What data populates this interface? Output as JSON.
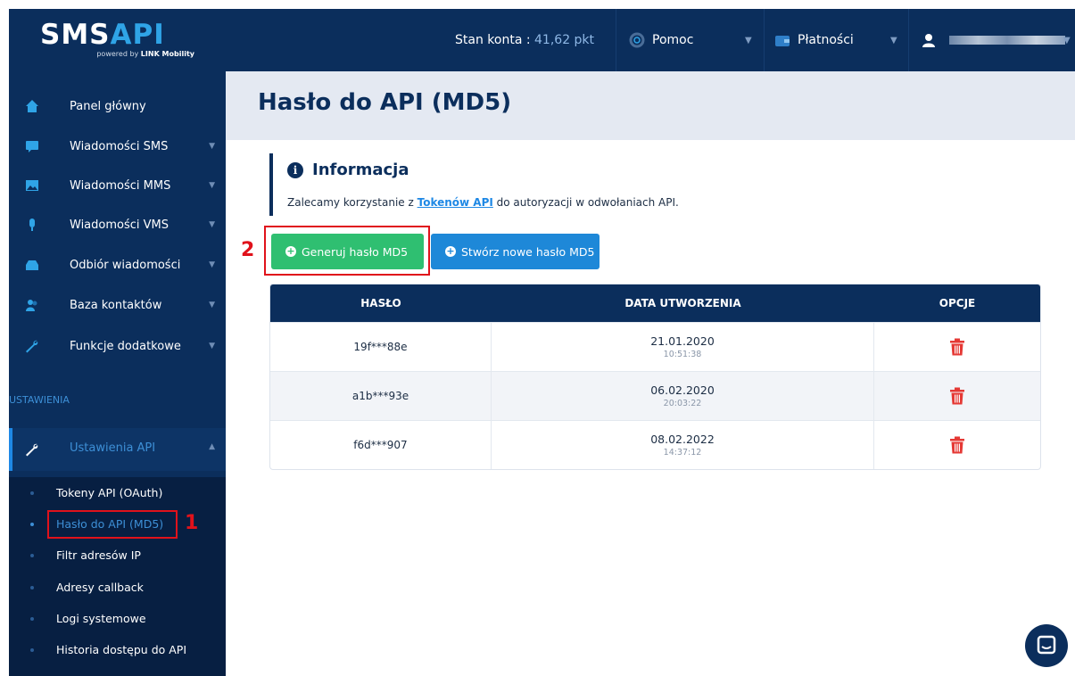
{
  "logo": {
    "brand_prefix": "SMS",
    "brand_suffix": "API",
    "tagline_prefix": "powered by ",
    "tagline_brand": "LINK Mobility"
  },
  "topbar": {
    "balance_label": "Stan konta : ",
    "balance_value": "41,62 pkt",
    "help_label": "Pomoc",
    "payments_label": "Płatności"
  },
  "sidebar": {
    "items": [
      {
        "label": "Panel główny",
        "icon": "home-icon"
      },
      {
        "label": "Wiadomości SMS",
        "icon": "sms-icon"
      },
      {
        "label": "Wiadomości MMS",
        "icon": "image-icon"
      },
      {
        "label": "Wiadomości VMS",
        "icon": "microphone-icon"
      },
      {
        "label": "Odbiór wiadomości",
        "icon": "inbox-icon"
      },
      {
        "label": "Baza kontaktów",
        "icon": "contacts-icon"
      },
      {
        "label": "Funkcje dodatkowe",
        "icon": "wrench-icon"
      }
    ],
    "section_label": "USTAWIENIA",
    "active_item": "Ustawienia API",
    "subitems": [
      "Tokeny API (OAuth)",
      "Hasło do API (MD5)",
      "Filtr adresów IP",
      "Adresy callback",
      "Logi systemowe",
      "Historia dostępu do API"
    ]
  },
  "page": {
    "title": "Hasło do API (MD5)"
  },
  "info": {
    "title": "Informacja",
    "text_before": "Zalecamy korzystanie z ",
    "link": "Tokenów API",
    "text_after": " do autoryzacji w odwołaniach API."
  },
  "buttons": {
    "generate": "Generuj hasło MD5",
    "create": "Stwórz nowe hasło MD5"
  },
  "annotations": {
    "mark1": "1",
    "mark2": "2"
  },
  "table": {
    "headers": [
      "HASŁO",
      "DATA UTWORZENIA",
      "OPCJE"
    ],
    "rows": [
      {
        "password": "19f***88e",
        "date": "21.01.2020",
        "time": "10:51:38"
      },
      {
        "password": "a1b***93e",
        "date": "06.02.2020",
        "time": "20:03:22"
      },
      {
        "password": "f6d***907",
        "date": "08.02.2022",
        "time": "14:37:12"
      }
    ]
  },
  "colors": {
    "navy": "#0b2e5c",
    "green": "#2fbf71",
    "blue": "#1e88d8",
    "danger": "#e53935",
    "annotation": "#e0121b"
  }
}
